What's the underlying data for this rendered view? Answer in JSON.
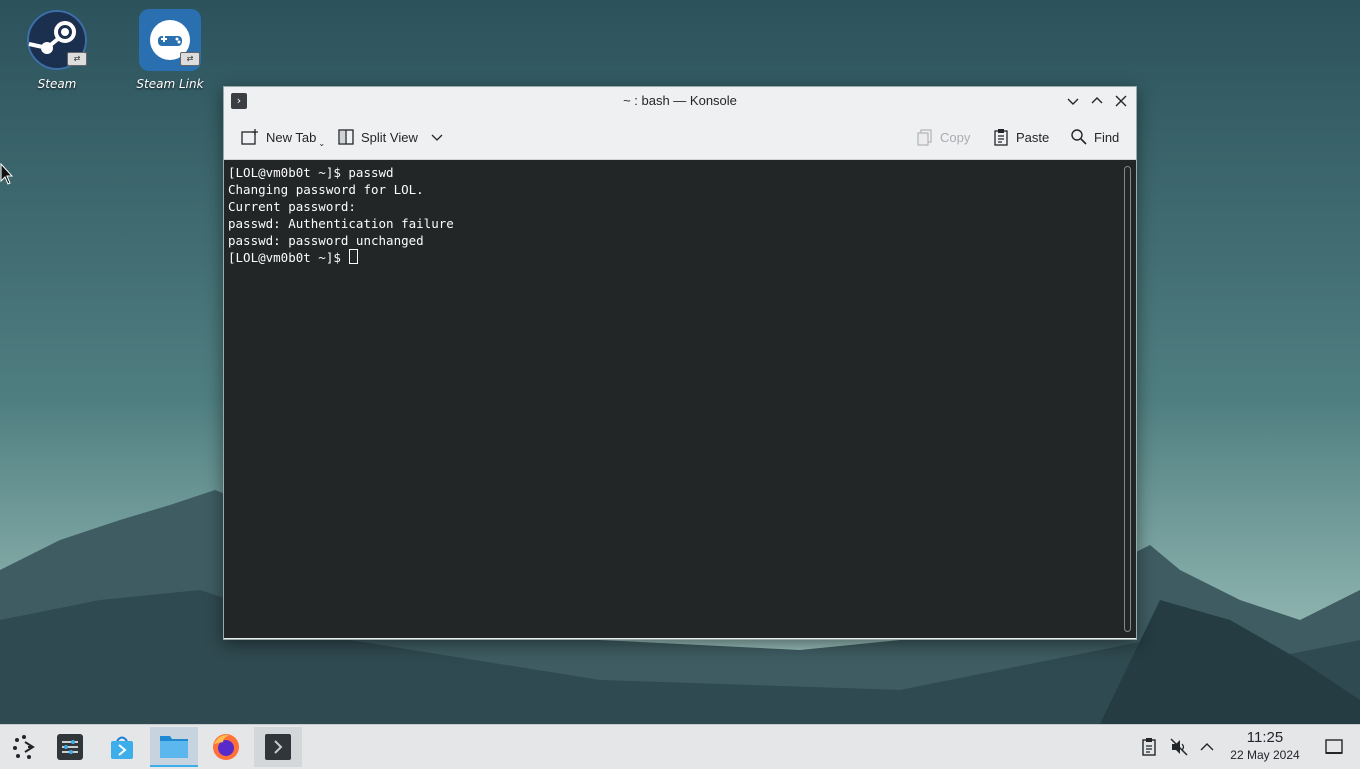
{
  "desktop": {
    "icons": [
      {
        "label": "Steam"
      },
      {
        "label": "Steam Link"
      }
    ]
  },
  "window": {
    "title": "~ : bash — Konsole",
    "toolbar": {
      "new_tab": "New Tab",
      "split_view": "Split View",
      "copy": "Copy",
      "paste": "Paste",
      "find": "Find"
    },
    "terminal": {
      "lines": [
        "[LOL@vm0b0t ~]$ passwd",
        "Changing password for LOL.",
        "Current password:",
        "passwd: Authentication failure",
        "passwd: password unchanged",
        "[LOL@vm0b0t ~]$ "
      ]
    }
  },
  "taskbar": {
    "items": [
      "application-launcher-icon",
      "system-settings-icon",
      "discover-store-icon",
      "dolphin-file-manager-icon",
      "firefox-icon",
      "konsole-icon"
    ],
    "clock": {
      "time": "11:25",
      "date": "22 May 2024"
    }
  },
  "colors": {
    "accent": "#3daee9",
    "terminal_bg": "#232627",
    "terminal_fg": "#fcfcfc"
  }
}
